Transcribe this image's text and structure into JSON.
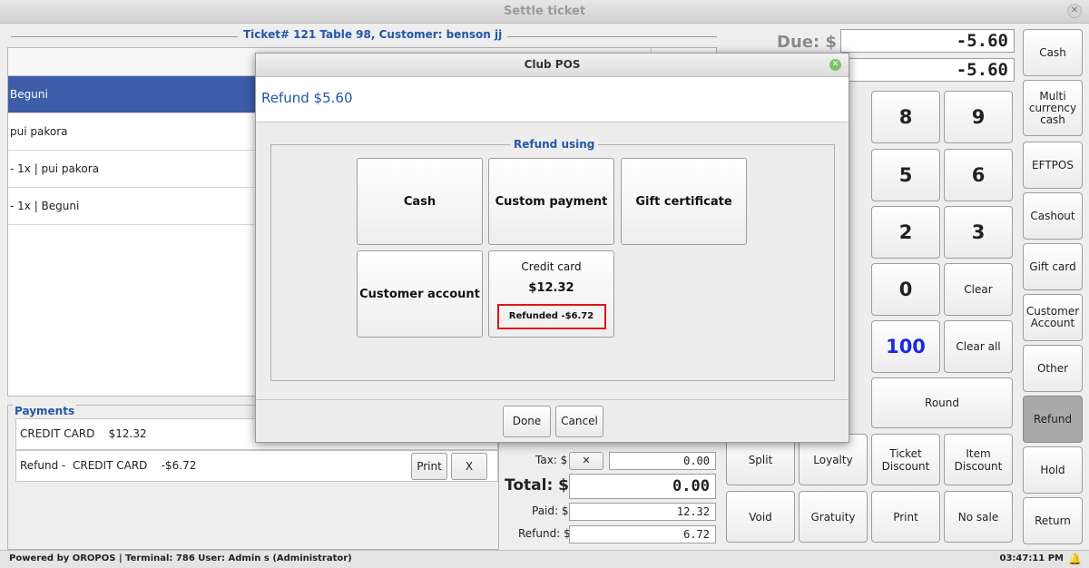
{
  "window": {
    "title": "Settle ticket"
  },
  "ticket": {
    "header": "Ticket# 121 Table 98, Customer: benson jj",
    "items": [
      "Beguni",
      "pui pakora",
      "- 1x | pui pakora",
      "- 1x | Beguni"
    ]
  },
  "payments": {
    "label": "Payments",
    "rows": [
      {
        "text": "CREDIT CARD    $12.32"
      },
      {
        "text": "Refund -  CREDIT CARD    -$6.72",
        "print": "Print",
        "remove": "X"
      }
    ]
  },
  "totals": {
    "due_label": "Due: $",
    "due_value": "-5.60",
    "tender_value": "-5.60",
    "tax_label": "Tax: $",
    "tax_x": "✕",
    "tax_value": "0.00",
    "total_label": "Total: $",
    "total_value": "0.00",
    "paid_label": "Paid: $",
    "paid_value": "12.32",
    "refund_label": "Refund: $",
    "refund_value": "6.72"
  },
  "keypad": {
    "k8": "8",
    "k9": "9",
    "k5": "5",
    "k6": "6",
    "k2": "2",
    "k3": "3",
    "k0": "0",
    "clear": "Clear",
    "k100": "100",
    "clear_all": "Clear all",
    "round": "Round",
    "split": "Split",
    "loyalty": "Loyalty",
    "ticket_discount": "Ticket Discount",
    "item_discount": "Item Discount",
    "void": "Void",
    "gratuity": "Gratuity",
    "print": "Print",
    "no_sale": "No sale"
  },
  "sidebar": {
    "cash": "Cash",
    "multi_currency": "Multi currency cash",
    "eftpos": "EFTPOS",
    "cashout": "Cashout",
    "gift_card": "Gift card",
    "customer_account": "Customer Account",
    "other": "Other",
    "refund": "Refund",
    "hold": "Hold",
    "return": "Return"
  },
  "status": {
    "left": "Powered by OROPOS | Terminal: 786 User: Admin s (Administrator)",
    "time": "03:47:11 PM"
  },
  "modal": {
    "title": "Club POS",
    "header": "Refund $5.60",
    "group_label": "Refund using",
    "options": {
      "cash": "Cash",
      "custom_payment": "Custom payment",
      "gift_certificate": "Gift certificate",
      "customer_account": "Customer account",
      "credit_card_title": "Credit card",
      "credit_card_amount": "$12.32",
      "credit_card_refunded": "Refunded -$6.72"
    },
    "done": "Done",
    "cancel": "Cancel"
  },
  "colors": {
    "accent_blue": "#2457a8",
    "selected_row": "#3d5da8",
    "highlight_red": "#e0161a",
    "key_100": "#1a2ae0"
  }
}
